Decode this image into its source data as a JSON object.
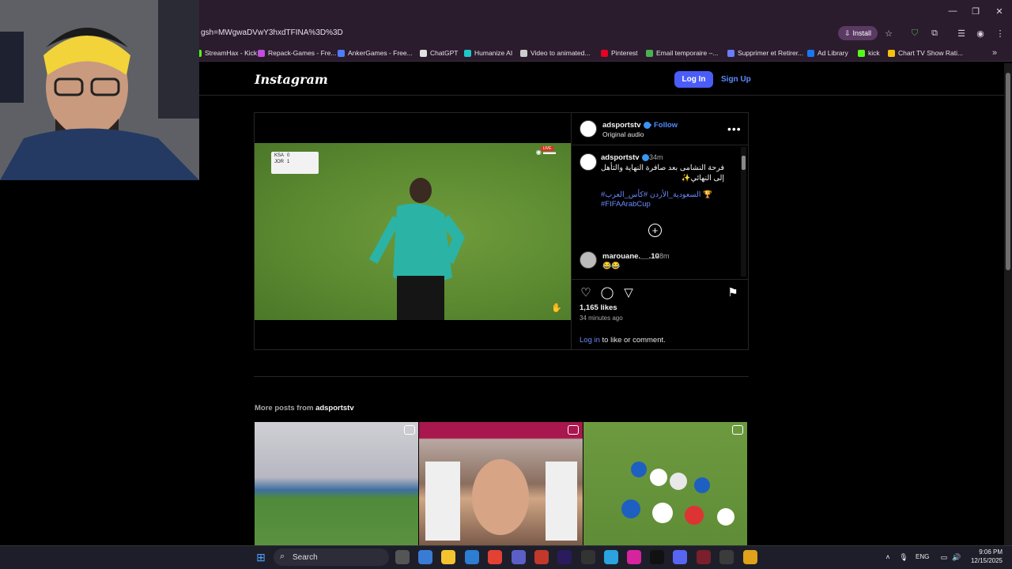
{
  "browser": {
    "url": "gsh=MWgwaDVwY3hxdTFINA%3D%3D",
    "install_label": "Install",
    "bookmarks": [
      {
        "label": "StreamHax - Kick",
        "color": "#53fc18"
      },
      {
        "label": "Repack-Games - Fre...",
        "color": "#c24de0"
      },
      {
        "label": "AnkerGames - Free...",
        "color": "#4f7cff"
      },
      {
        "label": "ChatGPT",
        "color": "#e0e0e0"
      },
      {
        "label": "Humanize AI",
        "color": "#1fc8c8"
      },
      {
        "label": "Video to animated...",
        "color": "#cccccc"
      },
      {
        "label": "Pinterest",
        "color": "#e60023"
      },
      {
        "label": "Email temporaire –...",
        "color": "#4caf50"
      },
      {
        "label": "Supprimer et Retirer...",
        "color": "#6a7dff"
      },
      {
        "label": "Ad Library",
        "color": "#1877f2"
      },
      {
        "label": "kick",
        "color": "#53fc18"
      },
      {
        "label": "Chart TV Show Rati...",
        "color": "#f4c20d"
      }
    ]
  },
  "instagram": {
    "logo": "Instagram",
    "login_label": "Log In",
    "signup_label": "Sign Up",
    "post": {
      "owner": "adsportstv",
      "follow_label": "Follow",
      "follow_sep": "•",
      "audio": "Original audio",
      "caption_user": "adsportstv",
      "caption_time": "34m",
      "caption_text": "فرحة النشامى بعد صافرة النهاية والتأهل إلى النهائي✨",
      "caption_tags": "#السعودية_الأردن #كأس_العرب 🏆 #FIFAArabCup",
      "comment_user": "marouane.__.10",
      "comment_time": "28m",
      "comment_text": "😂😂",
      "likes": "1,165 likes",
      "age": "34 minutes ago",
      "login_link": "Log in",
      "login_suffix": " to like or comment."
    },
    "video": {
      "score_home": "KSA",
      "score_home_val": "0",
      "score_away": "JOR",
      "score_away_val": "1",
      "live_label": "LIVE"
    },
    "more_posts_prefix": "More posts from ",
    "more_posts_user": "adsportstv"
  },
  "taskbar": {
    "search_label": "Search",
    "lang": "ENG",
    "time": "9:06 PM",
    "date": "12/15/2025"
  },
  "colors": {
    "accent_blue": "#4a5df9",
    "link_blue": "#4f8bff",
    "chrome_bg": "#2a1c2c"
  }
}
